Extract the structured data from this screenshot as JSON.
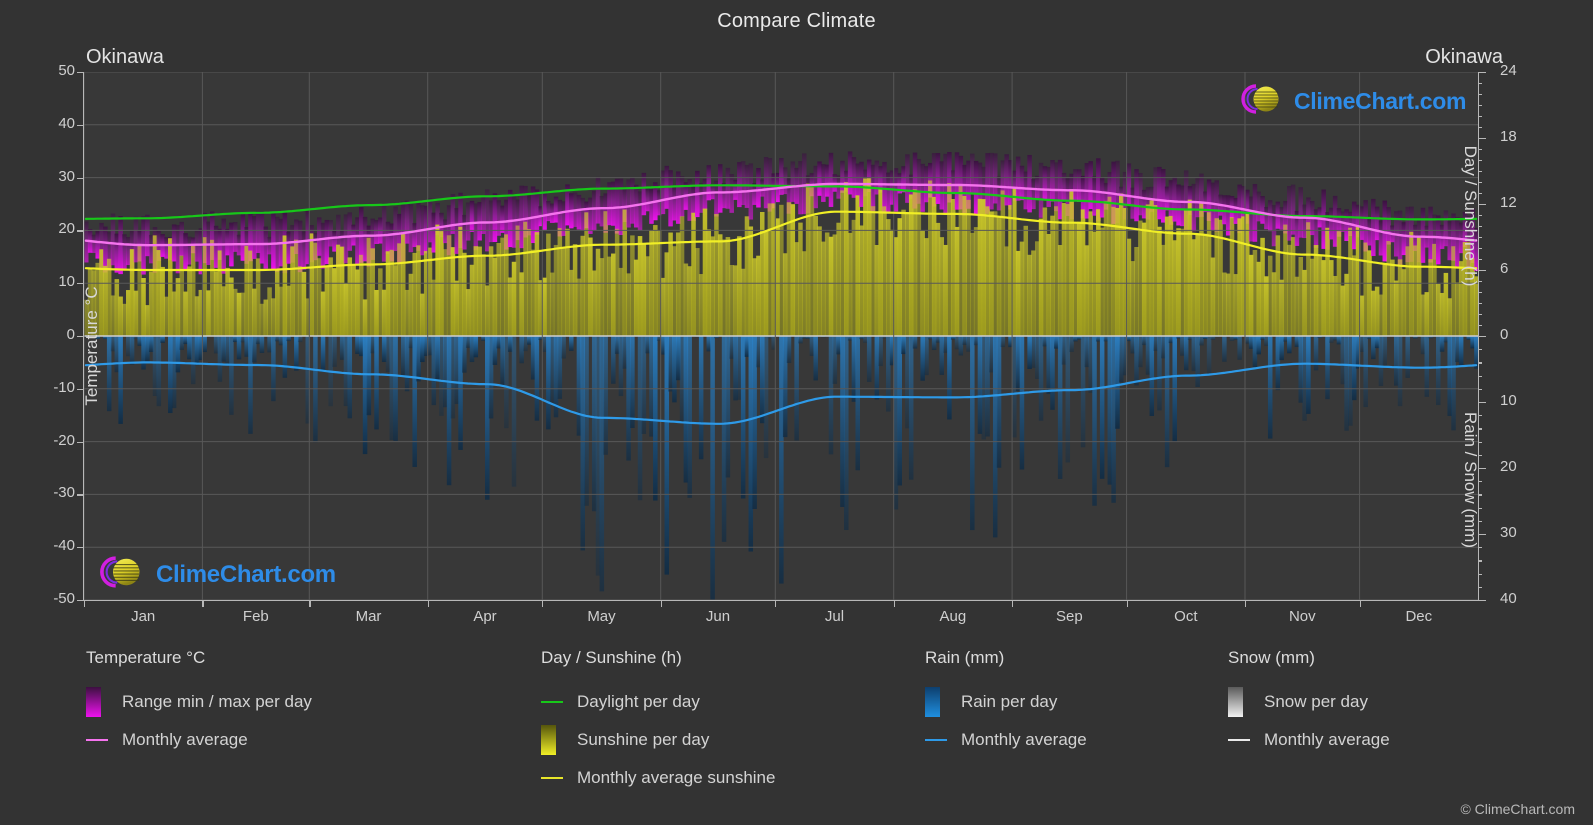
{
  "header": {
    "title": "Compare Climate",
    "location_left": "Okinawa",
    "location_right": "Okinawa"
  },
  "watermark": {
    "text": "ClimeChart.com",
    "logo_icon": "climechart-logo-icon",
    "logo_crescent_color": "#d11fe0",
    "logo_sphere_color": "#d8cc22",
    "text_color": "#2e8ce8"
  },
  "footer": {
    "copyright": "© ClimeChart.com"
  },
  "colors": {
    "background": "#333333",
    "plot_background": "#383838",
    "grid": "#585858",
    "temp_range_dark": "#3c1040",
    "temp_range_bright": "#ee11ee",
    "temp_avg_line": "#f573ee",
    "daylight_line": "#17c819",
    "sunshine_fill": "#b2b01e",
    "sunshine_line": "#f1ef26",
    "rain_fill": "#1b6fbd",
    "rain_line": "#2e9ae8",
    "snow_fill": "#e8e8e8",
    "snow_line": "#e8e8e8"
  },
  "axes": {
    "left": {
      "title": "Temperature °C",
      "ticks": [
        50,
        40,
        30,
        20,
        10,
        0,
        -10,
        -20,
        -30,
        -40,
        -50
      ],
      "min": -50,
      "max": 50
    },
    "right_top": {
      "title": "Day / Sunshine (h)",
      "ticks": [
        24,
        18,
        12,
        6,
        0
      ],
      "min": 0,
      "max": 24
    },
    "right_bottom": {
      "title": "Rain / Snow (mm)",
      "ticks": [
        0,
        10,
        20,
        30,
        40
      ],
      "min": 0,
      "max": 40
    },
    "x": {
      "ticks": [
        "Jan",
        "Feb",
        "Mar",
        "Apr",
        "May",
        "Jun",
        "Jul",
        "Aug",
        "Sep",
        "Oct",
        "Nov",
        "Dec"
      ]
    }
  },
  "legend": {
    "columns": [
      {
        "header": "Temperature °C",
        "items": [
          {
            "label": "Range min / max per day",
            "style": "box",
            "color": "#ee11ee",
            "color2": "#3c1040"
          },
          {
            "label": "Monthly average",
            "style": "line",
            "color": "#f573ee"
          }
        ]
      },
      {
        "header": "Day / Sunshine (h)",
        "items": [
          {
            "label": "Daylight per day",
            "style": "line",
            "color": "#17c819"
          },
          {
            "label": "Sunshine per day",
            "style": "box",
            "color": "#f1ef26",
            "color2": "#55550c"
          },
          {
            "label": "Monthly average sunshine",
            "style": "line",
            "color": "#e8e62a"
          }
        ]
      },
      {
        "header": "Rain (mm)",
        "items": [
          {
            "label": "Rain per day",
            "style": "box",
            "color": "#1f8fe0",
            "color2": "#0d3f6e"
          },
          {
            "label": "Monthly average",
            "style": "line",
            "color": "#2e9ae8"
          }
        ]
      },
      {
        "header": "Snow (mm)",
        "items": [
          {
            "label": "Snow per day",
            "style": "box",
            "color": "#f2f2f2",
            "color2": "#5a5a5a"
          },
          {
            "label": "Monthly average",
            "style": "line",
            "color": "#eaeaea"
          }
        ]
      }
    ]
  },
  "chart_data": {
    "type": "area",
    "title": "Compare Climate",
    "subtitle": "Okinawa",
    "xlabel": "",
    "ylabel": "Temperature °C",
    "grid": true,
    "legend_position": "bottom",
    "categories": [
      "Jan",
      "Feb",
      "Mar",
      "Apr",
      "May",
      "Jun",
      "Jul",
      "Aug",
      "Sep",
      "Oct",
      "Nov",
      "Dec"
    ],
    "axis_left": {
      "label": "Temperature °C",
      "min": -50,
      "max": 50,
      "ticks": [
        50,
        40,
        30,
        20,
        10,
        0,
        -10,
        -20,
        -30,
        -40,
        -50
      ]
    },
    "axis_right_top": {
      "label": "Day / Sunshine (h)",
      "min": 0,
      "max": 24,
      "ticks": [
        24,
        18,
        12,
        6,
        0
      ]
    },
    "axis_right_bottom": {
      "label": "Rain / Snow (mm)",
      "min": 0,
      "max": 40,
      "ticks": [
        0,
        10,
        20,
        30,
        40
      ]
    },
    "series": [
      {
        "name": "Monthly average",
        "unit": "°C",
        "axis": "left",
        "color": "#f573ee",
        "values": [
          17.2,
          17.4,
          19.0,
          21.5,
          24.2,
          27.2,
          28.8,
          28.6,
          27.6,
          25.4,
          22.4,
          18.8
        ]
      },
      {
        "name": "Range max per day",
        "unit": "°C",
        "axis": "left",
        "color": "#ee11ee",
        "values": [
          19.6,
          19.9,
          21.7,
          24.2,
          27.0,
          29.8,
          31.6,
          31.3,
          30.2,
          27.9,
          24.8,
          21.3
        ]
      },
      {
        "name": "Range min per day",
        "unit": "°C",
        "axis": "left",
        "color": "#ee11ee",
        "values": [
          14.8,
          15.0,
          16.5,
          19.2,
          22.2,
          25.2,
          26.5,
          26.3,
          25.3,
          22.9,
          19.8,
          16.4
        ]
      },
      {
        "name": "Daylight per day",
        "unit": "h",
        "axis": "right_top",
        "color": "#17c819",
        "values": [
          10.7,
          11.2,
          11.9,
          12.7,
          13.4,
          13.7,
          13.6,
          13.0,
          12.3,
          11.5,
          10.9,
          10.6
        ]
      },
      {
        "name": "Monthly average sunshine",
        "unit": "h",
        "axis": "right_top",
        "color": "#e8e62a",
        "values": [
          6.0,
          6.0,
          6.5,
          7.3,
          8.3,
          8.6,
          11.3,
          11.1,
          10.3,
          9.3,
          7.4,
          6.3
        ]
      },
      {
        "name": "Rain monthly average",
        "unit": "mm",
        "axis": "right_bottom",
        "color": "#2e9ae8",
        "values": [
          4.0,
          4.4,
          5.8,
          7.3,
          12.4,
          13.3,
          9.2,
          9.3,
          8.2,
          6.0,
          4.2,
          4.8
        ]
      },
      {
        "name": "Snow monthly average",
        "unit": "mm",
        "axis": "right_bottom",
        "color": "#eaeaea",
        "values": [
          0,
          0,
          0,
          0,
          0,
          0,
          0,
          0,
          0,
          0,
          0,
          0
        ]
      }
    ]
  }
}
